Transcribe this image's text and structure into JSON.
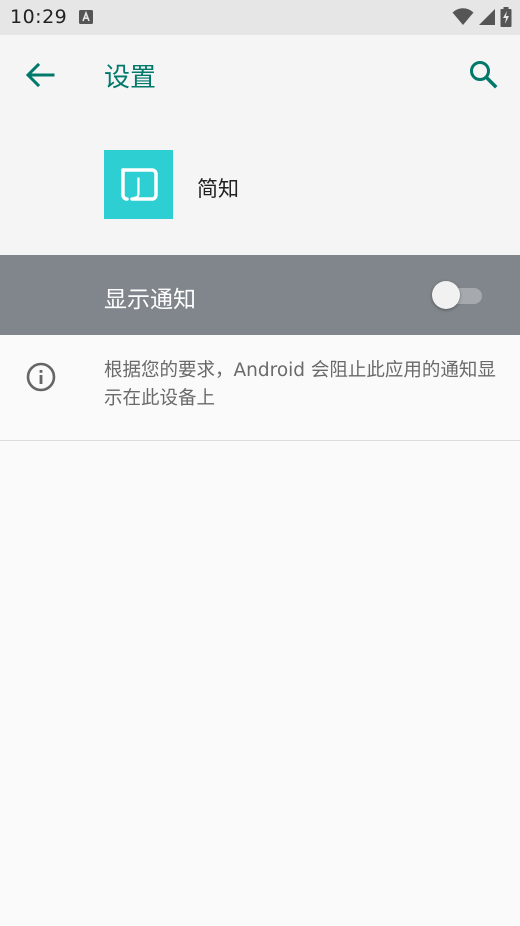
{
  "status_bar": {
    "time": "10:29"
  },
  "app_bar": {
    "title": "设置"
  },
  "app_header": {
    "app_name": "简知",
    "icon_letter": "J",
    "icon_color": "#2ecfd2"
  },
  "master_switch": {
    "label": "显示通知",
    "enabled": false
  },
  "info": {
    "text": "根据您的要求，Android 会阻止此应用的通知显示在此设备上"
  },
  "colors": {
    "accent": "#00796b",
    "switch_row_bg": "#80868b"
  },
  "icons": {
    "back": "arrow-left-icon",
    "search": "search-icon",
    "info": "info-icon",
    "wifi": "wifi-icon",
    "signal": "signal-icon",
    "battery": "battery-charging-icon",
    "notification": "notification-app-icon"
  }
}
